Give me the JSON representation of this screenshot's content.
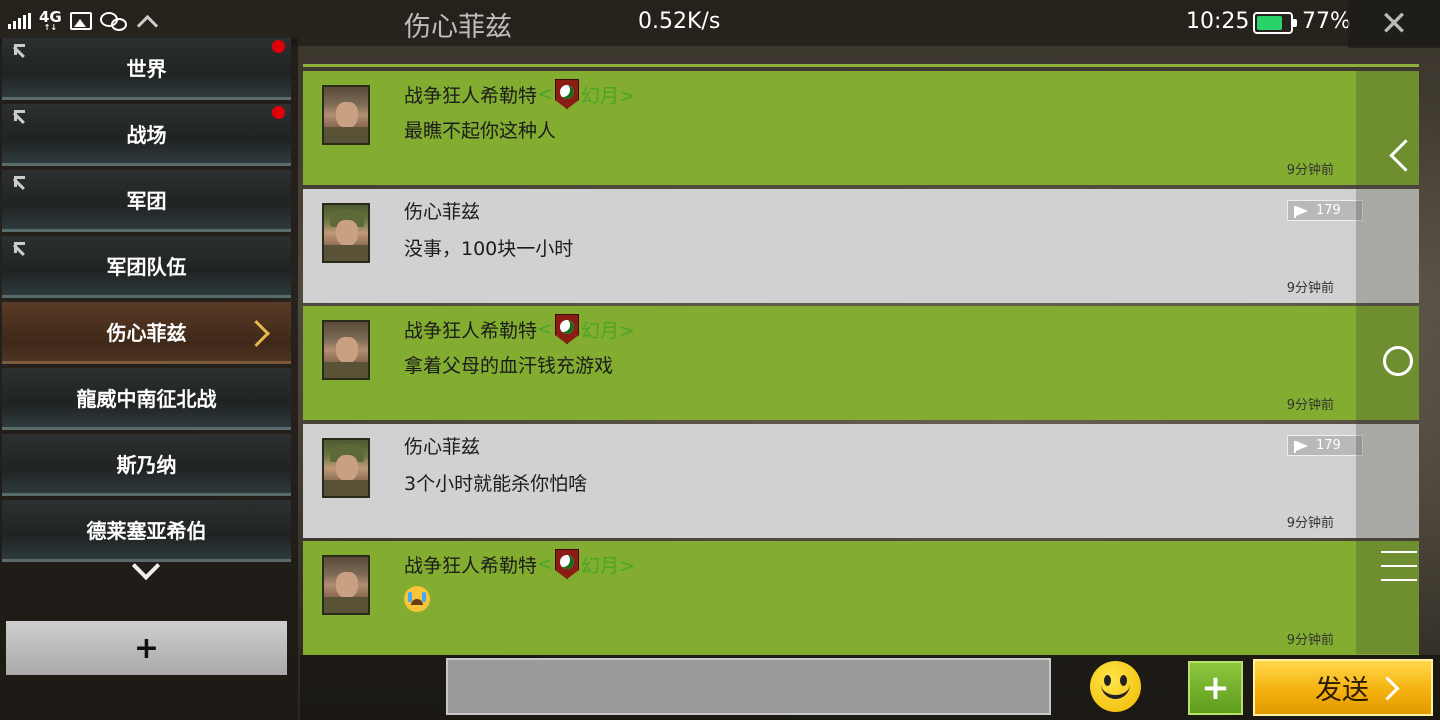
{
  "status_bar": {
    "network": "4G",
    "title": "伤心菲兹",
    "speed": "0.52K/s",
    "time": "10:25",
    "battery": "77%",
    "battery_level": 0.77,
    "battery_color": "#28d36a"
  },
  "sidebar": {
    "items": [
      {
        "label": "世界",
        "pinned": true,
        "unread": true,
        "active": false
      },
      {
        "label": "战场",
        "pinned": true,
        "unread": true,
        "active": false
      },
      {
        "label": "军团",
        "pinned": true,
        "unread": false,
        "active": false
      },
      {
        "label": "军团队伍",
        "pinned": true,
        "unread": false,
        "active": false
      },
      {
        "label": "伤心菲兹",
        "pinned": false,
        "unread": false,
        "active": true
      },
      {
        "label": "龍威中南征北战",
        "pinned": false,
        "unread": false,
        "active": false
      },
      {
        "label": "斯乃纳",
        "pinned": false,
        "unread": false,
        "active": false
      },
      {
        "label": "德莱塞亚希伯",
        "pinned": false,
        "unread": false,
        "active": false
      }
    ],
    "add_label": "+"
  },
  "messages": [
    {
      "sender": "战争狂人希勒特",
      "guild_prefix": "<",
      "guild_name": "幻月>",
      "text": "最瞧不起你这种人",
      "time": "9分钟前",
      "style": "green"
    },
    {
      "sender": "伤心菲兹",
      "vip": "179",
      "text": "没事，100块一小时",
      "time": "9分钟前",
      "style": "gray"
    },
    {
      "sender": "战争狂人希勒特",
      "guild_prefix": "<",
      "guild_name": "幻月>",
      "text": "拿着父母的血汗钱充游戏",
      "time": "9分钟前",
      "style": "green"
    },
    {
      "sender": "伤心菲兹",
      "vip": "179",
      "text": "3个小时就能杀你怕啥",
      "time": "9分钟前",
      "style": "gray"
    },
    {
      "sender": "战争狂人希勒特",
      "guild_prefix": "<",
      "guild_name": "幻月>",
      "text": "",
      "emoji": "crying-face",
      "time": "9分钟前",
      "style": "green"
    }
  ],
  "colors": {
    "message_green": "#82ad30",
    "message_gray": "#d1d1d1",
    "guild_text": "#4aa528",
    "send_button": "#f5b20f",
    "unread_dot": "#e0000a"
  },
  "input": {
    "value": "",
    "placeholder": ""
  },
  "buttons": {
    "send_label": "发送",
    "plus_label": "+",
    "close_label": "✕"
  }
}
